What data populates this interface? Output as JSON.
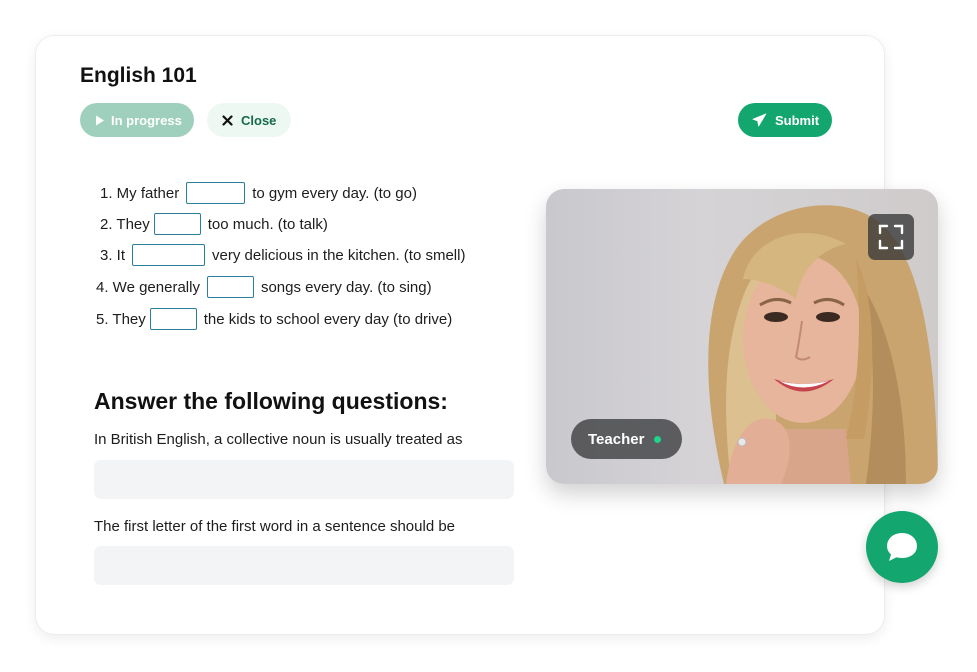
{
  "lesson": {
    "title": "English 101",
    "status_label": "In progress",
    "close_label": "Close",
    "submit_label": "Submit"
  },
  "exercises": [
    {
      "before": "1. My father",
      "after": "to gym every day. (to go)"
    },
    {
      "before": "2. They",
      "after": "too much. (to talk)"
    },
    {
      "before": "3. It",
      "after": "very delicious in the kitchen. (to smell)"
    },
    {
      "before": "4. We generally",
      "after": "songs every day. (to sing)"
    },
    {
      "before": "5. They",
      "after": "the kids to school every day (to drive)"
    }
  ],
  "questions": {
    "heading": "Answer the following questions:",
    "items": [
      {
        "prompt": "In British English, a collective noun is usually treated as"
      },
      {
        "prompt": "The first letter of the first word in a sentence should be"
      }
    ]
  },
  "video": {
    "participant_label": "Teacher",
    "participant_status": "online"
  },
  "colors": {
    "accent": "#14a66f",
    "accent_light": "#9fd0bd",
    "close_bg": "#eef8f3",
    "blank_border": "#2b7f99",
    "online_dot": "#1ed488"
  },
  "icons": {
    "status": "play-icon",
    "close": "x-icon",
    "submit": "send-icon",
    "expand": "fullscreen-icon",
    "chat": "chat-bubble-icon"
  }
}
